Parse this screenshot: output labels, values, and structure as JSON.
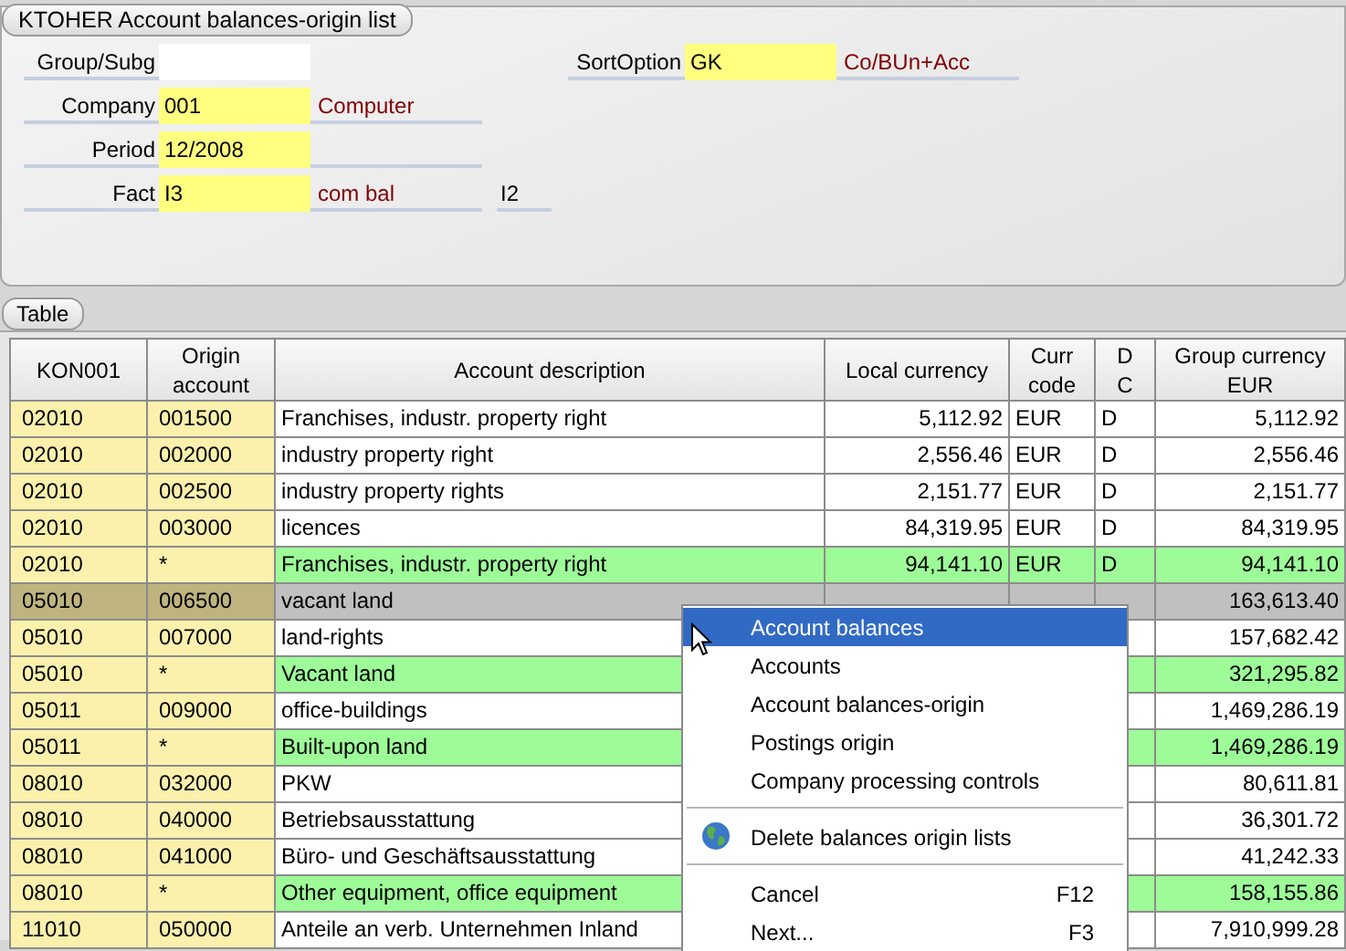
{
  "title_tab": "KTOHER Account balances-origin list",
  "fields": [
    {
      "label": "Group/Subg",
      "required": false
    },
    {
      "label": "Company",
      "value": "001",
      "description": "Computer",
      "required": true
    },
    {
      "label": "Period",
      "value": "12/2008",
      "required": true
    },
    {
      "label": "Fact",
      "value": "I3",
      "description": "com bal",
      "extra": "I2",
      "required": true
    }
  ],
  "sort_option": {
    "label": "SortOption",
    "value": "GK",
    "description": "Co/BUn+Acc",
    "required": true
  },
  "table_tab": "Table",
  "columns": [
    "KON001",
    "Origin account",
    "Account description",
    "Local currency",
    "Curr code",
    "D C",
    "Group currency EUR"
  ],
  "rows": [
    {
      "kon": "02010",
      "origin": "001500",
      "description": "Franchises, industr. property right",
      "local": "5,112.92",
      "curr": "EUR",
      "dc": "D",
      "group": "5,112.92",
      "kind": "detail",
      "selected": false
    },
    {
      "kon": "02010",
      "origin": "002000",
      "description": "industry property right",
      "local": "2,556.46",
      "curr": "EUR",
      "dc": "D",
      "group": "2,556.46",
      "kind": "detail",
      "selected": false
    },
    {
      "kon": "02010",
      "origin": "002500",
      "description": "industry property rights",
      "local": "2,151.77",
      "curr": "EUR",
      "dc": "D",
      "group": "2,151.77",
      "kind": "detail",
      "selected": false
    },
    {
      "kon": "02010",
      "origin": "003000",
      "description": "licences",
      "local": "84,319.95",
      "curr": "EUR",
      "dc": "D",
      "group": "84,319.95",
      "kind": "detail",
      "selected": false
    },
    {
      "kon": "02010",
      "origin": "*",
      "description": "Franchises, industr. property right",
      "local": "94,141.10",
      "curr": "EUR",
      "dc": "D",
      "group": "94,141.10",
      "kind": "subtotal",
      "selected": false
    },
    {
      "kon": "05010",
      "origin": "006500",
      "description": "vacant land",
      "group": "163,613.40",
      "kind": "detail",
      "selected": true
    },
    {
      "kon": "05010",
      "origin": "007000",
      "description": "land-rights",
      "group": "157,682.42",
      "kind": "detail",
      "selected": false
    },
    {
      "kon": "05010",
      "origin": "*",
      "description": "Vacant land",
      "group": "321,295.82",
      "kind": "subtotal",
      "selected": false
    },
    {
      "kon": "05011",
      "origin": "009000",
      "description": "office-buildings",
      "group": "1,469,286.19",
      "kind": "detail",
      "selected": false
    },
    {
      "kon": "05011",
      "origin": "*",
      "description": "Built-upon land",
      "group": "1,469,286.19",
      "kind": "subtotal",
      "selected": false
    },
    {
      "kon": "08010",
      "origin": "032000",
      "description": "PKW",
      "group": "80,611.81",
      "kind": "detail",
      "selected": false
    },
    {
      "kon": "08010",
      "origin": "040000",
      "description": "Betriebsausstattung",
      "group": "36,301.72",
      "kind": "detail",
      "selected": false
    },
    {
      "kon": "08010",
      "origin": "041000",
      "description": "Büro- und Geschäftsausstattung",
      "group": "41,242.33",
      "kind": "detail",
      "selected": false
    },
    {
      "kon": "08010",
      "origin": "*",
      "description": "Other equipment, office equipment",
      "group": "158,155.86",
      "kind": "subtotal",
      "selected": false
    },
    {
      "kon": "11010",
      "origin": "050000",
      "description": "Anteile an verb. Unternehmen Inland",
      "group": "7,910,999.28",
      "kind": "detail",
      "selected": false
    }
  ],
  "context_menu": [
    {
      "kind": "item",
      "label": "Account balances",
      "selected": true
    },
    {
      "kind": "item",
      "label": "Accounts",
      "selected": false
    },
    {
      "kind": "item",
      "label": "Account balances-origin",
      "selected": false
    },
    {
      "kind": "item",
      "label": "Postings origin",
      "selected": false
    },
    {
      "kind": "item",
      "label": "Company processing controls",
      "selected": false
    },
    {
      "kind": "separator"
    },
    {
      "kind": "action",
      "label": "Delete balances origin lists",
      "selected": false
    },
    {
      "kind": "separator"
    },
    {
      "kind": "item",
      "label": "Cancel",
      "shortcut": "F12",
      "selected": false
    },
    {
      "kind": "item",
      "label": "Next...",
      "shortcut": "F3",
      "selected": false
    }
  ]
}
